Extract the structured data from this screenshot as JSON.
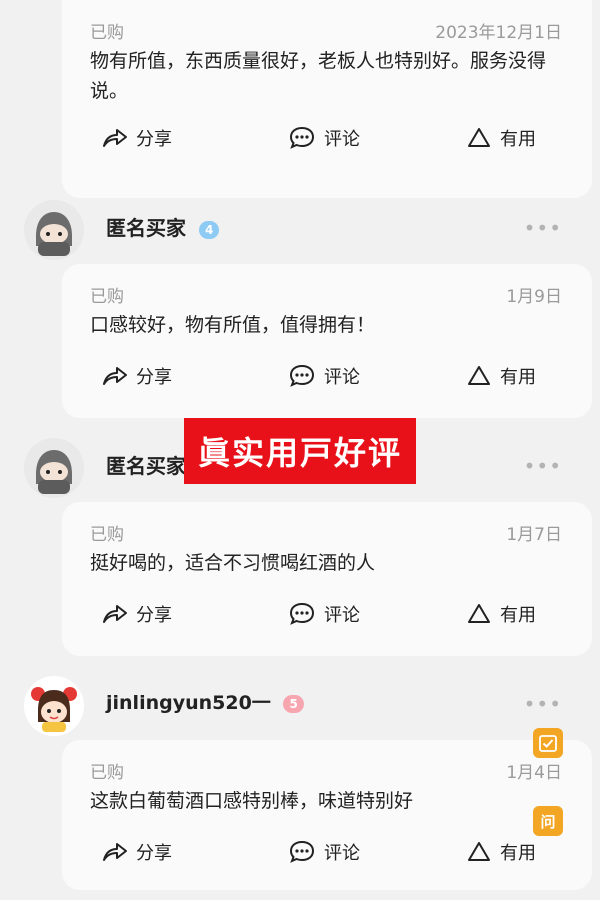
{
  "reviews": [
    {
      "tag": "已购",
      "date": "2023年12月1日",
      "text": "物有所值，东西质量很好，老板人也特别好。服务没得说。"
    },
    {
      "user": "匿名买家",
      "badge": "4",
      "tag": "已购",
      "date": "1月9日",
      "text": "口感较好，物有所值，值得拥有！"
    },
    {
      "user": "匿名买家",
      "badge": "",
      "tag": "已购",
      "date": "1月7日",
      "text": "挺好喝的，适合不习惯喝红酒的人"
    },
    {
      "user": "jinlingyun520一",
      "badge": "5",
      "tag": "已购",
      "date": "1月4日",
      "text": "这款白葡萄酒口感特别棒，味道特别好"
    }
  ],
  "actions": {
    "share": "分享",
    "comment": "评论",
    "useful": "有用"
  },
  "more_label": "•••",
  "banner": "眞实用戸好评",
  "float_ask": "问",
  "icons": [
    "share-icon",
    "comment-icon",
    "useful-icon",
    "check-icon",
    "ask-icon",
    "diamond-icon",
    "heart-icon"
  ],
  "colors": {
    "banner": "#e8111a",
    "float": "#f3a524",
    "badge_blue": "#8ecbf4",
    "badge_pink": "#f7a6b0"
  }
}
